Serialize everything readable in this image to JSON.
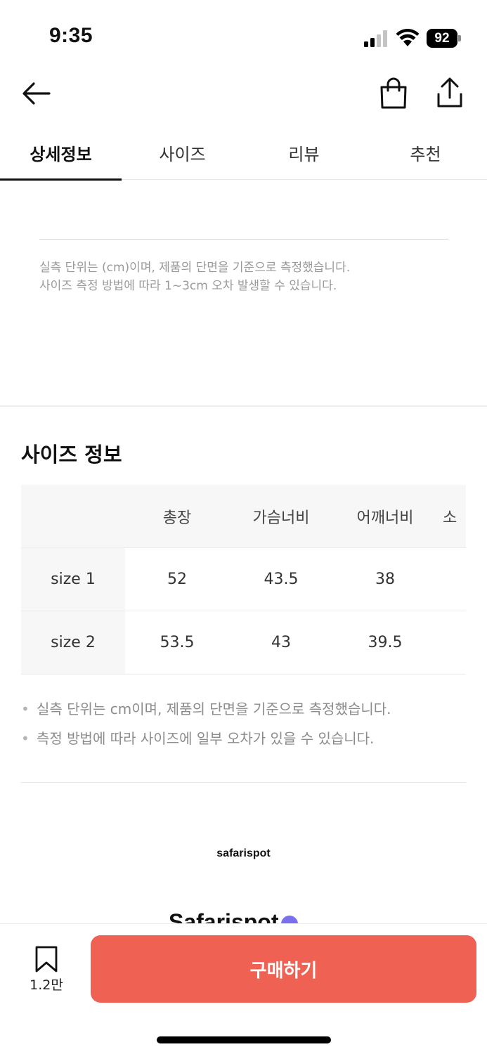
{
  "status_bar": {
    "time": "9:35",
    "battery": "92",
    "icons": [
      "signal-icon",
      "wifi-icon",
      "battery-icon"
    ]
  },
  "nav": {
    "icons": [
      "back-arrow-icon",
      "shopping-bag-icon",
      "share-icon"
    ]
  },
  "tabs": [
    {
      "label": "상세정보",
      "active": true
    },
    {
      "label": "사이즈",
      "active": false
    },
    {
      "label": "리뷰",
      "active": false
    },
    {
      "label": "추천",
      "active": false
    }
  ],
  "upper_note": {
    "line1": "실측 단위는 (cm)이며, 제품의 단면을 기준으로 측정했습니다.",
    "line2": "사이즈 측정 방법에 따라 1~3cm 오차 발생할 수 있습니다."
  },
  "size_info": {
    "title": "사이즈 정보",
    "headers": [
      "",
      "총장",
      "가슴너비",
      "어깨너비",
      "소"
    ],
    "rows": [
      {
        "label": "size 1",
        "values": [
          "52",
          "43.5",
          "38"
        ]
      },
      {
        "label": "size 2",
        "values": [
          "53.5",
          "43",
          "39.5"
        ]
      }
    ],
    "notes": [
      "실측 단위는 cm이며, 제품의 단면을 기준으로 측정했습니다.",
      "측정 방법에 따라 사이즈에 일부 오차가 있을 수 있습니다."
    ]
  },
  "brand": {
    "logo_text": "safarispot",
    "name": "Safarispot"
  },
  "bottom_bar": {
    "bookmark_count": "1.2만",
    "buy_label": "구매하기",
    "buy_color": "#ef6152"
  }
}
